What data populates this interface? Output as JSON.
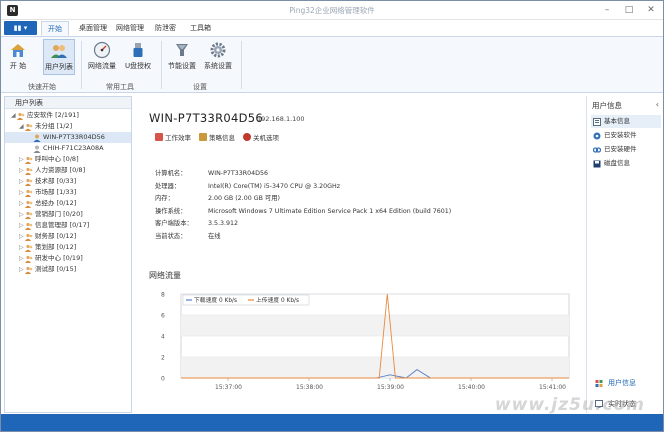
{
  "window": {
    "title": "Ping32企业网络管理软件"
  },
  "menu": {
    "file_label": "▮▮ ▾",
    "tabs": [
      {
        "label": "开始",
        "active": true
      },
      {
        "label": "桌面管理"
      },
      {
        "label": "网络管理"
      },
      {
        "label": "防泄密"
      },
      {
        "label": "工具箱"
      }
    ]
  },
  "ribbon": {
    "buttons": [
      {
        "label": "开 始",
        "icon": "home-icon"
      },
      {
        "label": "用户列表",
        "icon": "users-icon",
        "active": true
      },
      {
        "label": "网络流量",
        "icon": "gauge-icon"
      },
      {
        "label": "U盘授权",
        "icon": "usb-icon"
      },
      {
        "label": "节能设置",
        "icon": "energy-icon"
      },
      {
        "label": "系统设置",
        "icon": "gear-icon"
      }
    ],
    "groups": [
      "快速开始",
      "常用工具",
      "设置"
    ]
  },
  "tree": {
    "header": "用户列表",
    "rows": [
      {
        "label": "应安软件  [2/191]",
        "expand": "◢",
        "icon": "group-icon"
      },
      {
        "label": "未分组  [1/2]",
        "expand": "◢",
        "icon": "group-icon"
      },
      {
        "label": "WIN-P7T33R04D56",
        "expand": "",
        "icon": "computer-online-icon",
        "selected": true
      },
      {
        "label": "CHIH-F71C23A08A",
        "expand": "",
        "icon": "computer-offline-icon"
      },
      {
        "label": "呼叫中心  [0/8]",
        "expand": "▷",
        "icon": "group-icon"
      },
      {
        "label": "人力资源部  [0/8]",
        "expand": "▷",
        "icon": "group-icon"
      },
      {
        "label": "技术部  [0/33]",
        "expand": "▷",
        "icon": "group-icon"
      },
      {
        "label": "市场部  [1/33]",
        "expand": "▷",
        "icon": "group-icon"
      },
      {
        "label": "总经办  [0/12]",
        "expand": "▷",
        "icon": "group-icon"
      },
      {
        "label": "营销部门  [0/20]",
        "expand": "▷",
        "icon": "group-icon"
      },
      {
        "label": "信息管理部  [0/17]",
        "expand": "▷",
        "icon": "group-icon"
      },
      {
        "label": "财务部  [0/12]",
        "expand": "▷",
        "icon": "group-icon"
      },
      {
        "label": "策划部  [0/12]",
        "expand": "▷",
        "icon": "group-icon"
      },
      {
        "label": "研发中心  [0/19]",
        "expand": "▷",
        "icon": "group-icon"
      },
      {
        "label": "测试部  [0/15]",
        "expand": "▷",
        "icon": "group-icon"
      }
    ]
  },
  "host": {
    "name": "WIN-P7T33R04D56",
    "ip": "192.168.1.100",
    "actions": [
      {
        "label": "工作效率",
        "icon": "efficiency-icon"
      },
      {
        "label": "策略信息",
        "icon": "policy-icon"
      },
      {
        "label": "关机选项",
        "icon": "power-icon"
      }
    ],
    "info": [
      {
        "k": "计算机名：",
        "v": "WIN-P7T33R04D56"
      },
      {
        "k": "处理器：",
        "v": "Intel(R) Core(TM) i5-3470 CPU @ 3.20GHz"
      },
      {
        "k": "内存：",
        "v": "2.00 GB (2.00 GB 可用)"
      },
      {
        "k": "操作系统：",
        "v": "Microsoft Windows 7 Ultimate Edition Service Pack 1 x64 Edition (build 7601)"
      },
      {
        "k": "客户端版本：",
        "v": "3.5.3.912"
      },
      {
        "k": "当前状态：",
        "v": "在线"
      }
    ]
  },
  "traffic": {
    "title": "网络流量"
  },
  "chart_data": {
    "type": "line",
    "ylim": [
      0,
      8
    ],
    "yticks": [
      "0",
      "2",
      "4",
      "6",
      "8"
    ],
    "xticks": [
      "15:37:00",
      "15:38:00",
      "15:39:00",
      "15:40:00",
      "15:41:00"
    ],
    "legend_position": "top-left",
    "series": [
      {
        "name": "下载速度 0 Kb/s",
        "color": "#5b7fc4",
        "x": [
          "15:36:00",
          "15:38:50",
          "15:39:00",
          "15:39:12",
          "15:39:20",
          "15:39:30",
          "15:41:30"
        ],
        "values": [
          0,
          0,
          0.3,
          0,
          0.8,
          0,
          0
        ]
      },
      {
        "name": "上传速度 0 Kb/s",
        "color": "#e8893c",
        "x": [
          "15:36:00",
          "15:38:52",
          "15:38:58",
          "15:39:04",
          "15:39:30",
          "15:41:30"
        ],
        "values": [
          0,
          0,
          8,
          0,
          0,
          0
        ]
      }
    ]
  },
  "right_panel": {
    "title": "用户信息",
    "items": [
      {
        "label": "基本信息",
        "icon": "info-icon",
        "active": true
      },
      {
        "label": "已安装软件",
        "icon": "software-icon"
      },
      {
        "label": "已安装硬件",
        "icon": "hardware-icon"
      },
      {
        "label": "磁盘信息",
        "icon": "disk-icon"
      }
    ],
    "bottom": [
      {
        "label": "用户信息",
        "icon": "user-info-icon"
      },
      {
        "label": "实时状态",
        "icon": "realtime-icon"
      }
    ]
  },
  "watermark": "www.jz5u.com"
}
